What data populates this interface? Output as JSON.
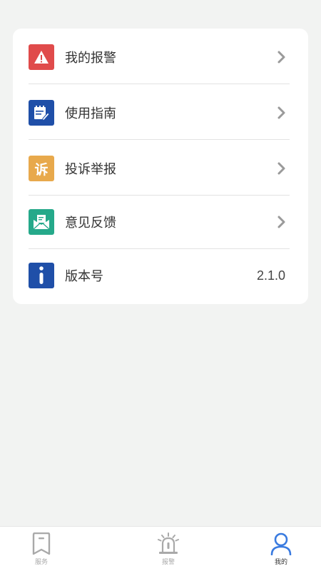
{
  "menu": {
    "items": [
      {
        "label": "我的报警",
        "icon": "warning-icon",
        "color": "#e04b4b"
      },
      {
        "label": "使用指南",
        "icon": "guide-icon",
        "color": "#1f4fa8"
      },
      {
        "label": "投诉举报",
        "icon": "complaint-icon",
        "glyph": "诉",
        "color": "#e8a94c"
      },
      {
        "label": "意见反馈",
        "icon": "feedback-mail-icon",
        "color": "#25a98a"
      }
    ],
    "version": {
      "label": "版本号",
      "value": "2.1.0",
      "icon": "info-icon",
      "color": "#1f4fa8"
    }
  },
  "tabbar": {
    "tabs": [
      {
        "label": "服务",
        "icon": "bookmark-icon",
        "active": false
      },
      {
        "label": "报警",
        "icon": "alarm-siren-icon",
        "active": false
      },
      {
        "label": "我的",
        "icon": "user-icon",
        "active": true
      }
    ],
    "active_color": "#3a7be0",
    "inactive_color": "#a9a9a9"
  }
}
